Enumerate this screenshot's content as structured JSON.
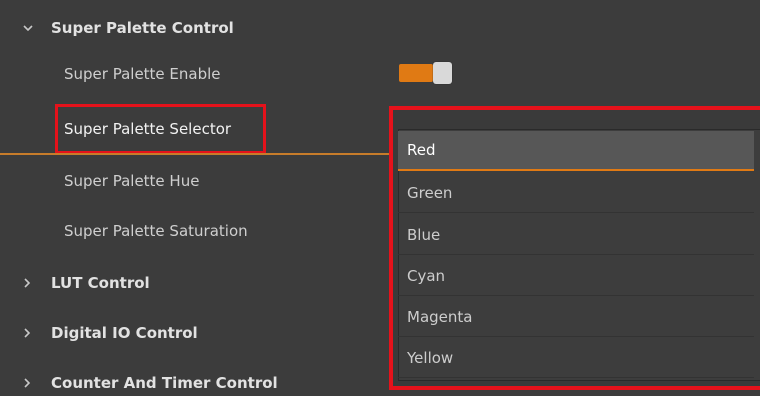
{
  "tree": {
    "super_palette": {
      "label": "Super Palette Control",
      "items": {
        "enable": "Super Palette Enable",
        "selector": "Super Palette Selector",
        "hue": "Super Palette Hue",
        "saturation": "Super Palette Saturation"
      },
      "enable_state": "on"
    },
    "lut": {
      "label": "LUT Control"
    },
    "digital_io": {
      "label": "Digital IO Control"
    },
    "counter_timer": {
      "label": "Counter And Timer Control"
    }
  },
  "selector_dropdown": {
    "options": [
      "Red",
      "Green",
      "Blue",
      "Cyan",
      "Magenta",
      "Yellow"
    ],
    "selected": "Red"
  },
  "colors": {
    "background": "#3c3c3c",
    "accent": "#e07a14",
    "highlight_box": "#e5121b"
  }
}
